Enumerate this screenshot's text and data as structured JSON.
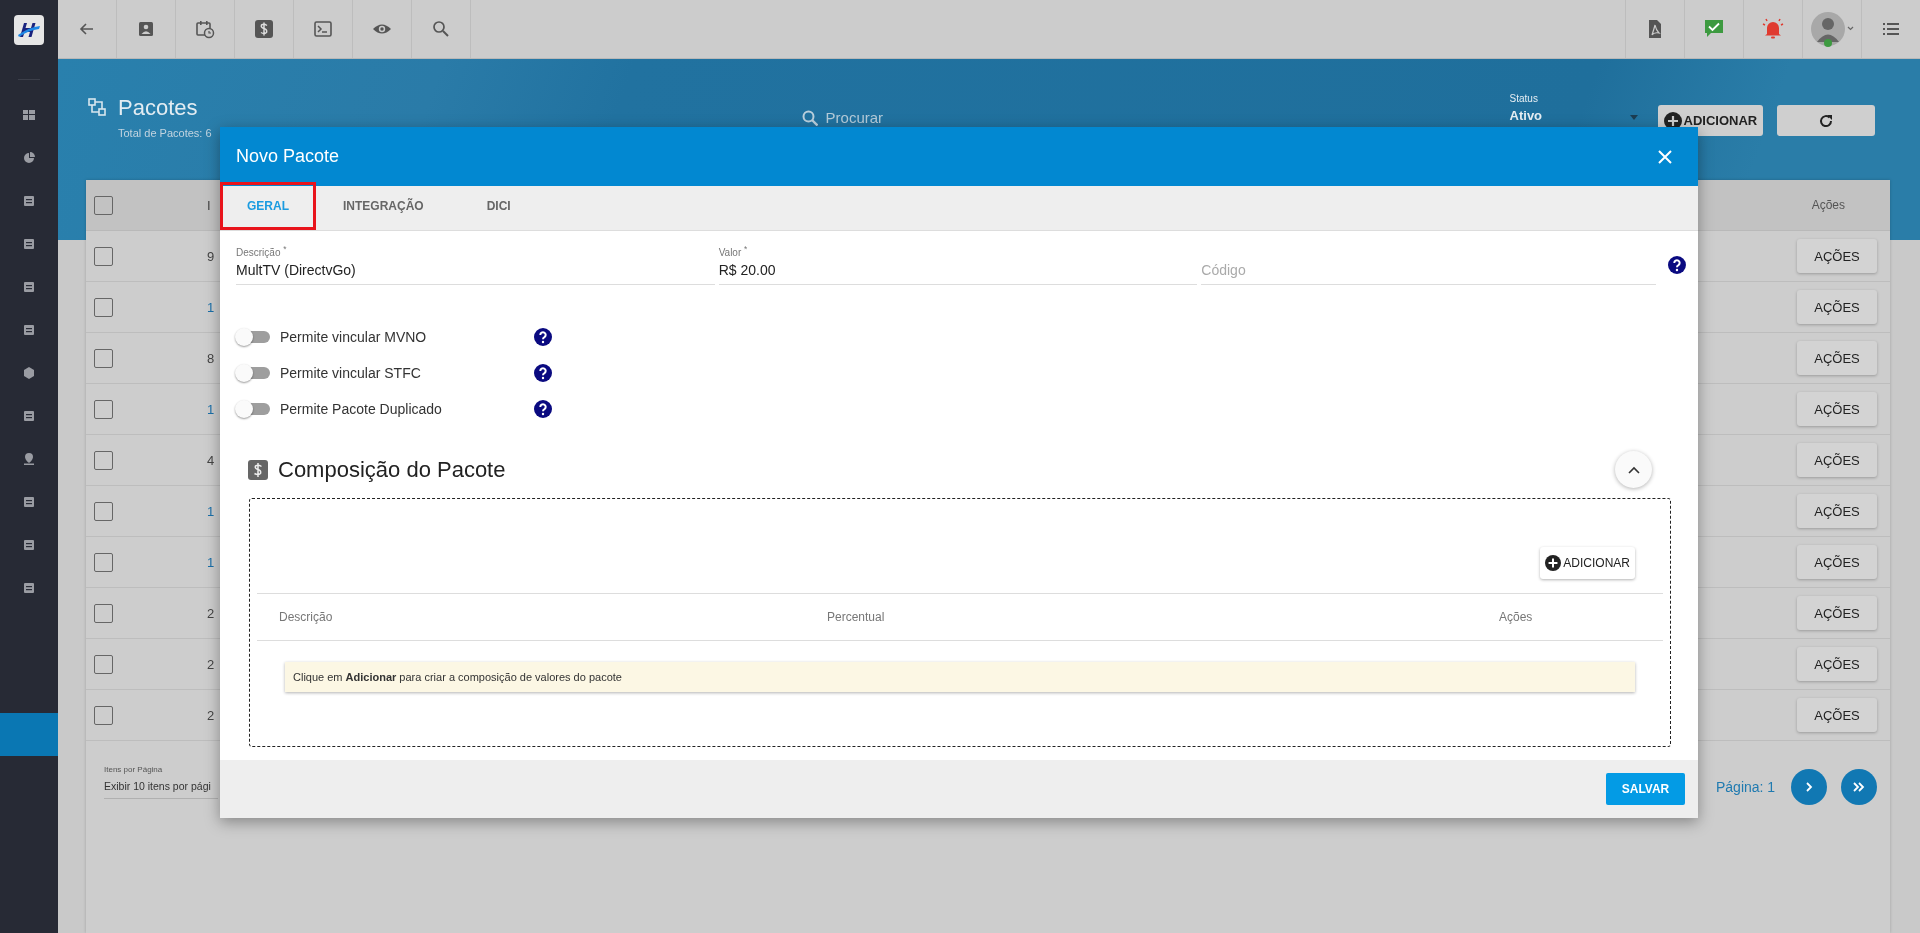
{
  "sidebar": {
    "items": [
      {
        "selected": false
      },
      {
        "selected": false
      },
      {
        "selected": false
      },
      {
        "selected": false
      },
      {
        "selected": false
      },
      {
        "selected": false
      },
      {
        "selected": false
      },
      {
        "selected": false
      },
      {
        "selected": false
      },
      {
        "selected": false
      },
      {
        "selected": false
      },
      {
        "selected": false
      },
      {
        "selected": true
      }
    ]
  },
  "header": {
    "title": "Pacotes",
    "subtitle": "Total de Pacotes: 6",
    "search_placeholder": "Procurar",
    "status_label": "Status",
    "status_value": "Ativo",
    "add_button": "ADICIONAR"
  },
  "table": {
    "select_all_checked": false,
    "columns": [
      "I",
      "Ações"
    ],
    "rows": [
      {
        "cell": "9",
        "link": false,
        "checked": false,
        "action": "AÇÕES"
      },
      {
        "cell": "1",
        "link": true,
        "checked": false,
        "action": "AÇÕES"
      },
      {
        "cell": "8",
        "link": false,
        "checked": false,
        "action": "AÇÕES"
      },
      {
        "cell": "1",
        "link": true,
        "checked": false,
        "action": "AÇÕES"
      },
      {
        "cell": "4",
        "link": false,
        "checked": false,
        "action": "AÇÕES"
      },
      {
        "cell": "1",
        "link": true,
        "checked": false,
        "action": "AÇÕES"
      },
      {
        "cell": "1",
        "link": true,
        "checked": false,
        "action": "AÇÕES"
      },
      {
        "cell": "2",
        "link": false,
        "checked": false,
        "action": "AÇÕES"
      },
      {
        "cell": "2",
        "link": false,
        "checked": false,
        "action": "AÇÕES"
      },
      {
        "cell": "2",
        "link": false,
        "checked": false,
        "action": "AÇÕES"
      }
    ]
  },
  "pagination": {
    "label": "Itens por Página",
    "value": "Exibir 10 itens por pági",
    "page": "Página: 1"
  },
  "modal": {
    "title": "Novo Pacote",
    "tabs": [
      {
        "label": "GERAL",
        "selected": true,
        "annotated": true
      },
      {
        "label": "INTEGRAÇÃO",
        "selected": false,
        "annotated": false
      },
      {
        "label": "DICI",
        "selected": false,
        "annotated": false
      }
    ],
    "fields": [
      {
        "label": "Descrição $^{*}$",
        "value": "MultTV (DirectvGo)"
      },
      {
        "label": "Valor $^{*}$",
        "value": "R$ 20.00"
      },
      {
        "placeholder": "Código"
      }
    ],
    "toggles": [
      {
        "label": "Permite vincular MVNO",
        "on": false
      },
      {
        "label": "Permite vincular STFC",
        "on": false
      },
      {
        "label": "Permite Pacote Duplicado",
        "on": false
      }
    ],
    "composition": {
      "title": "Composição do Pacote",
      "expanded": true,
      "add_button": "ADICIONAR",
      "columns": [
        "Descrição",
        "Percentual",
        "Ações"
      ],
      "empty_message": "Clique em **Adicionar** para criar a composição de valores do pacote"
    },
    "save_button": "SALVAR"
  }
}
